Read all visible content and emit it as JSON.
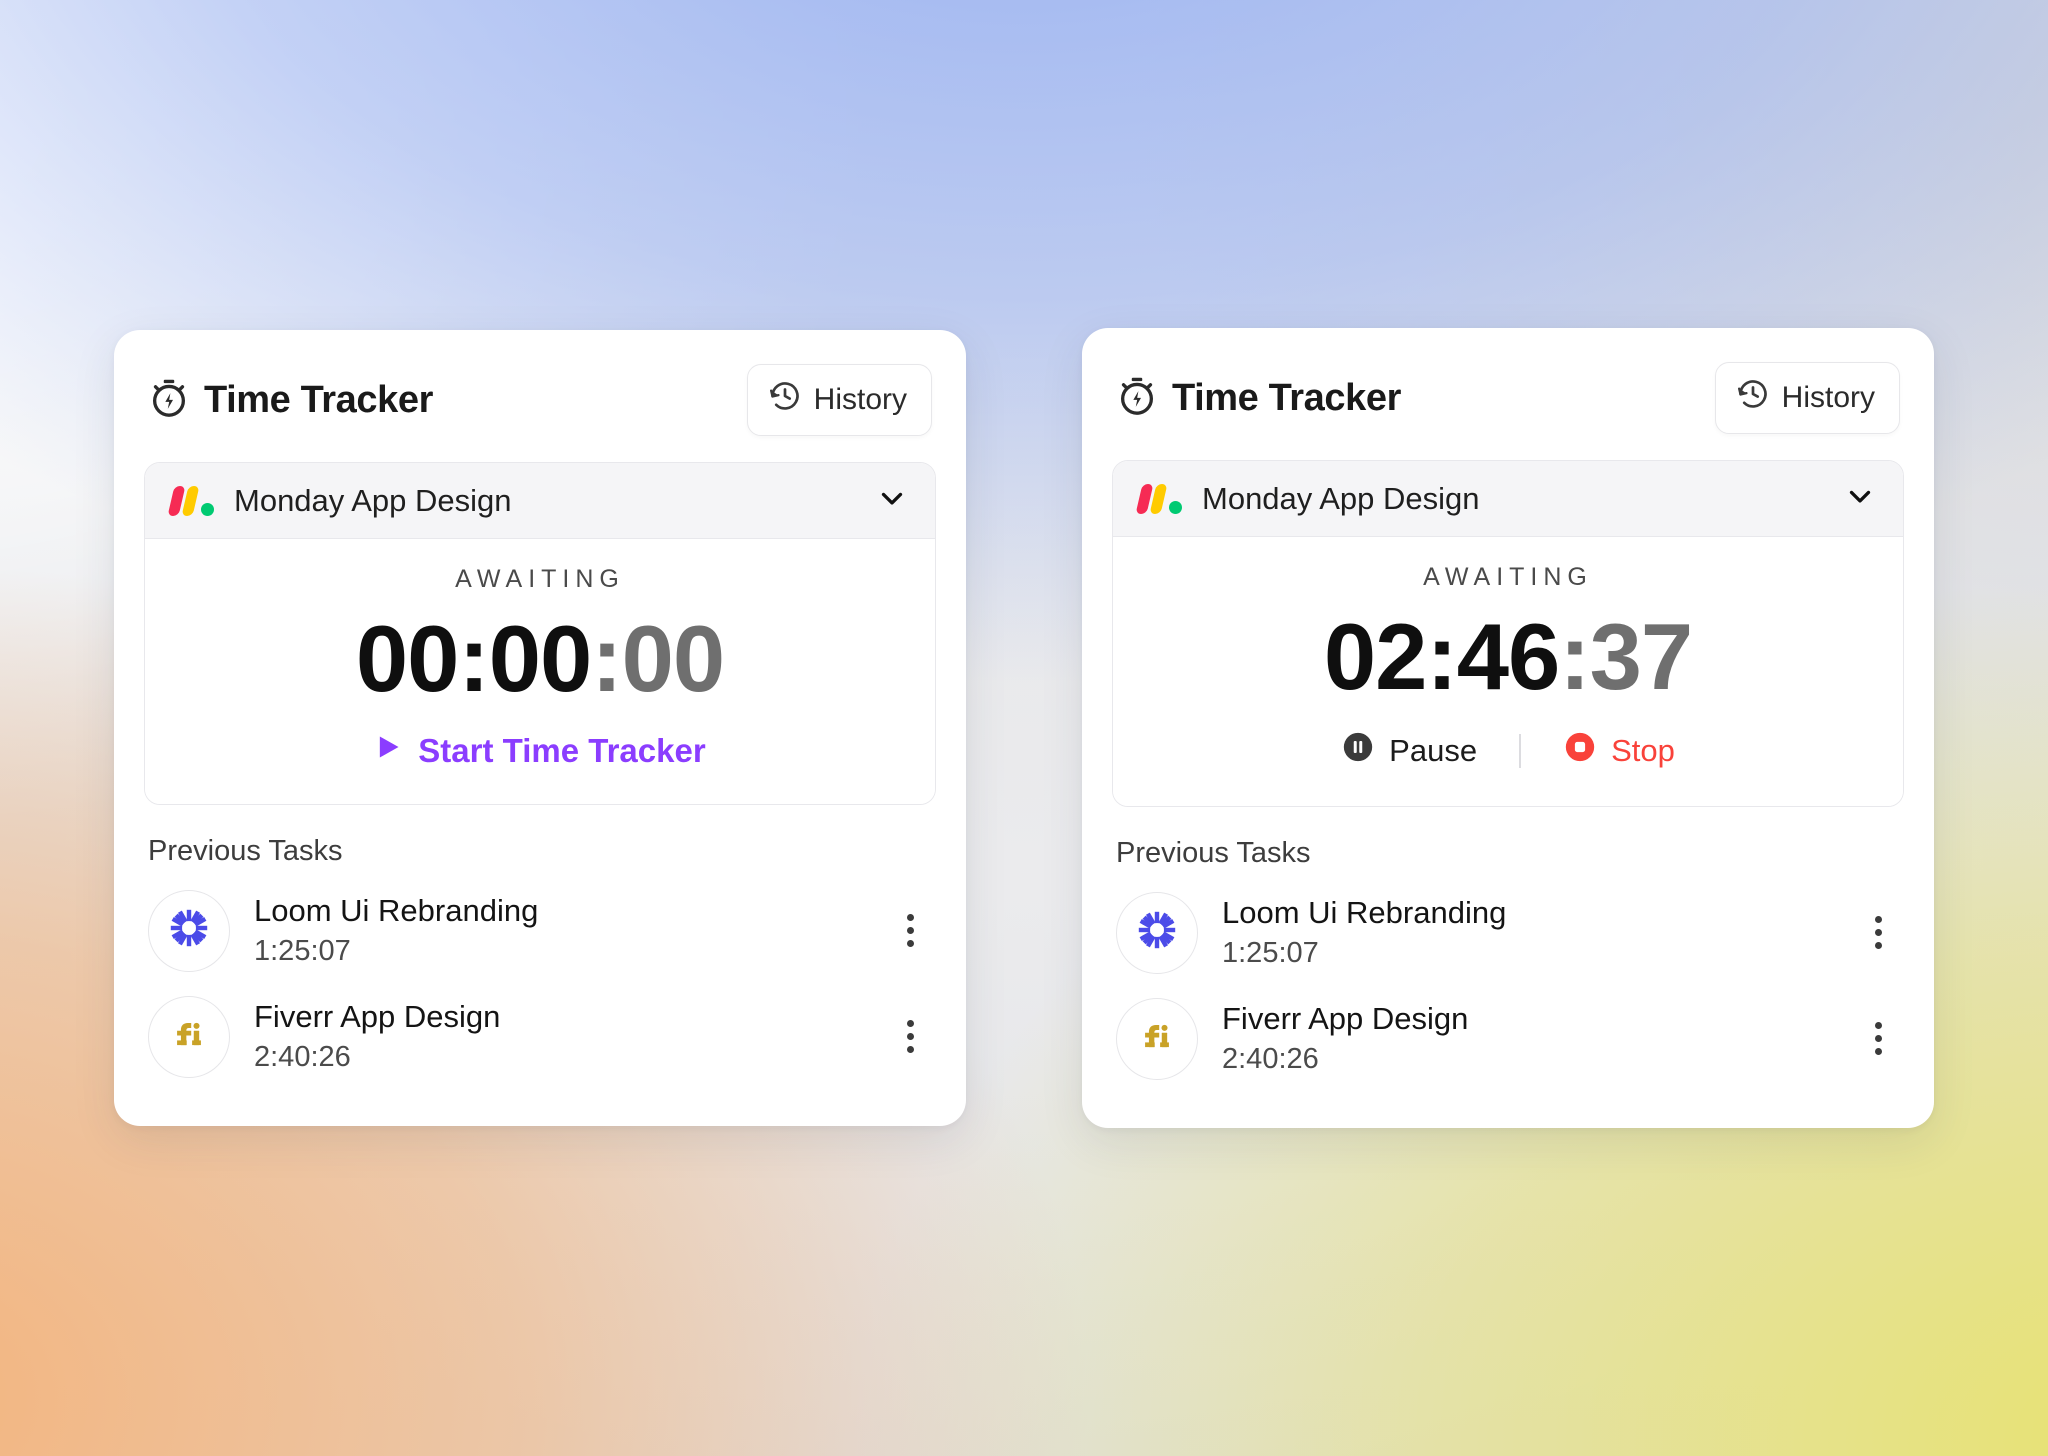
{
  "app": {
    "title": "Time Tracker",
    "stopwatch_icon": "stopwatch-bolt-icon",
    "history_label": "History",
    "history_icon": "history-clock-icon"
  },
  "project": {
    "name": "Monday App Design",
    "logo_icon": "monday-logo-icon",
    "chevron_icon": "chevron-down-icon"
  },
  "cards": [
    {
      "status": "AWAITING",
      "timer": {
        "hours": "00",
        "minutes": "00",
        "seconds": "00",
        "sep": ":"
      },
      "state": "idle",
      "start_label": "Start Time Tracker",
      "play_icon": "play-triangle-icon"
    },
    {
      "status": "AWAITING",
      "timer": {
        "hours": "02",
        "minutes": "46",
        "seconds": "37",
        "sep": ":"
      },
      "state": "running",
      "pause_label": "Pause",
      "pause_icon": "pause-circle-icon",
      "stop_label": "Stop",
      "stop_icon": "stop-circle-icon"
    }
  ],
  "previous": {
    "label": "Previous Tasks",
    "tasks": [
      {
        "name": "Loom Ui Rebranding",
        "time": "1:25:07",
        "icon": "loom-sunburst-icon",
        "menu_icon": "more-vertical-icon"
      },
      {
        "name": "Fiverr App Design",
        "time": "2:40:26",
        "icon": "fiverr-fi-icon",
        "menu_icon": "more-vertical-icon"
      }
    ]
  },
  "colors": {
    "accent_purple": "#8B3DFF",
    "stop_red": "#F9423A",
    "loom_blue": "#4B4BE8",
    "fiverr_gold": "#C9A227",
    "monday_red": "#F62B54",
    "monday_yellow": "#FFCB00",
    "monday_green": "#00CA72"
  }
}
